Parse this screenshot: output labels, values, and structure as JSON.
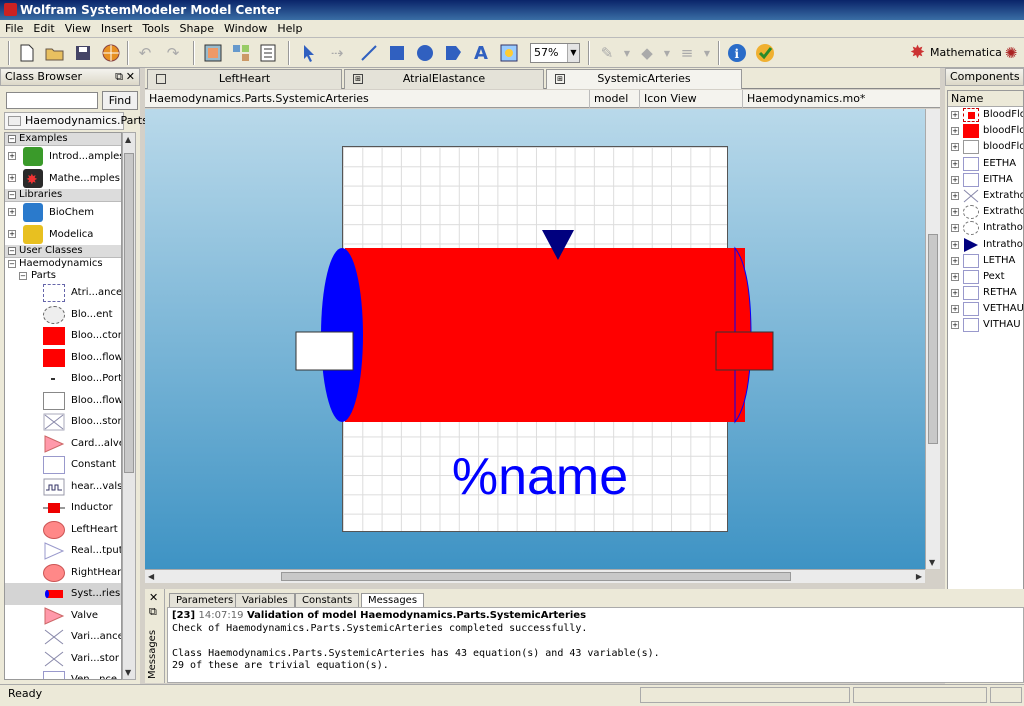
{
  "window": {
    "title": "Wolfram SystemModeler Model Center"
  },
  "menu": [
    "File",
    "Edit",
    "View",
    "Insert",
    "Tools",
    "Shape",
    "Window",
    "Help"
  ],
  "toolbar": {
    "zoom": "57%",
    "mathematica_label": "Mathematica"
  },
  "class_browser": {
    "title": "Class Browser",
    "find_label": "Find",
    "search_value": "",
    "package_path": "Haemodynamics.Parts",
    "sections": {
      "examples": "Examples",
      "libraries": "Libraries",
      "user_classes": "User Classes"
    },
    "examples": [
      "Introd...amples",
      "Mathe...mples"
    ],
    "libraries": [
      "BioChem",
      "Modelica"
    ],
    "user_tree": {
      "root": "Haemodynamics",
      "sub": "Parts"
    },
    "classes": [
      "Atri...ance",
      "Blo...ent",
      "Bloo...ctor",
      "Bloo...flow",
      "Bloo...Port",
      "Bloo...flow",
      "Bloo...stor",
      "Card...alve",
      "Constant",
      "hear...vals",
      "Inductor",
      "LeftHeart",
      "Real...tput",
      "RightHeart",
      "Syst...ries",
      "Valve",
      "Vari...ance",
      "Vari...stor",
      "Ven...nce"
    ]
  },
  "tabs": [
    "LeftHeart",
    "AtrialElastance",
    "SystemicArteries"
  ],
  "infobar": {
    "path": "Haemodynamics.Parts.SystemicArteries",
    "kind": "model",
    "view": "Icon View",
    "file": "Haemodynamics.mo*"
  },
  "diagram": {
    "name_label": "%name"
  },
  "components": {
    "title": "Components",
    "header": "Name",
    "items": [
      "BloodFlow",
      "bloodFlow",
      "bloodFlow",
      "EETHA",
      "EITHA",
      "Extrathor",
      "Extrathor",
      "Intrathora",
      "Intrathora",
      "LETHA",
      "Pext",
      "RETHA",
      "VETHAU",
      "VITHAU"
    ]
  },
  "messages": {
    "side_label": "Messages",
    "tabs": [
      "Parameters",
      "Variables",
      "Constants",
      "Messages"
    ],
    "entry_id": "[23]",
    "entry_time": "14:07:19",
    "entry_title": "Validation of model Haemodynamics.Parts.SystemicArteries",
    "lines": [
      "Check of Haemodynamics.Parts.SystemicArteries completed successfully.",
      "",
      "Class Haemodynamics.Parts.SystemicArteries has 43 equation(s) and 43 variable(s).",
      "29 of these are trivial equation(s)."
    ]
  },
  "status": {
    "text": "Ready"
  },
  "colors": {
    "vessel_red": "#ff0000",
    "vessel_blue": "#0000ff",
    "arrow_navy": "#00007f"
  }
}
